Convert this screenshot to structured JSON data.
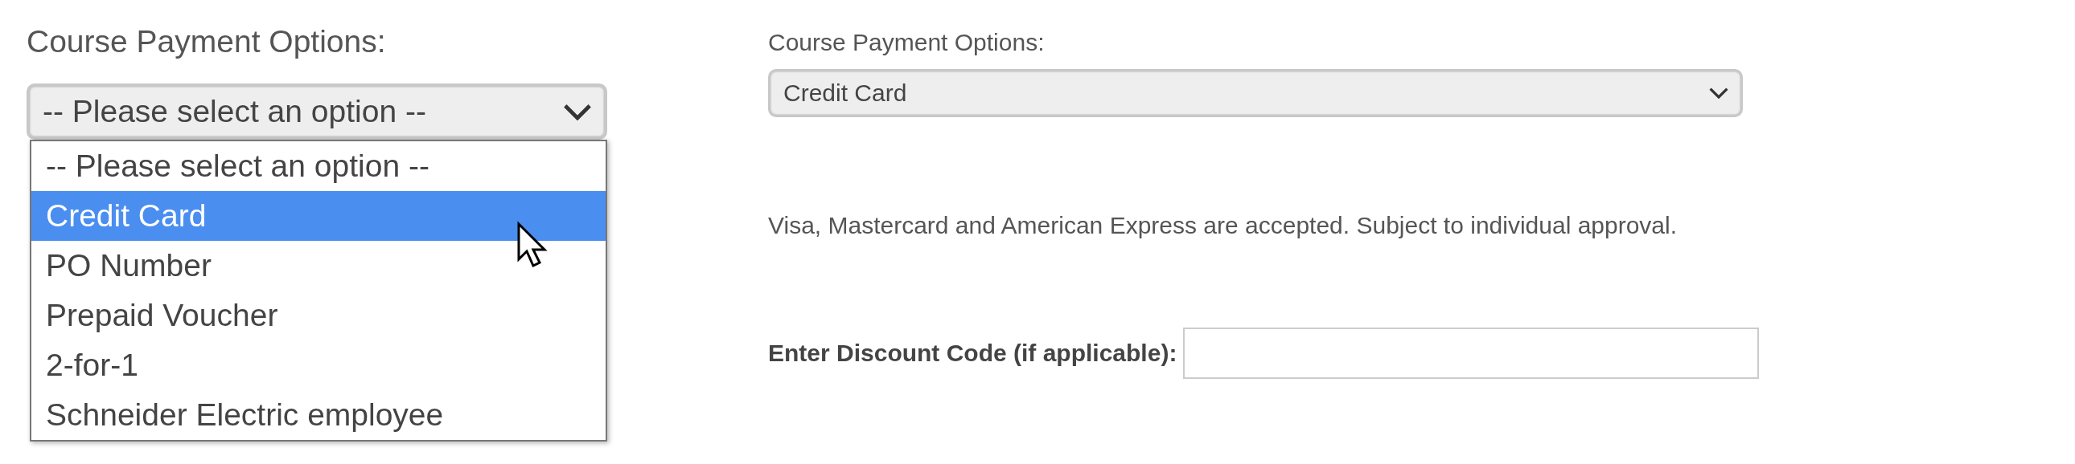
{
  "left_panel": {
    "label": "Course Payment Options:",
    "select": {
      "value": "-- Please select an option --",
      "expanded": true
    },
    "options": [
      {
        "label": "-- Please select an option --",
        "selected": false
      },
      {
        "label": "Credit Card",
        "selected": true
      },
      {
        "label": "PO Number",
        "selected": false
      },
      {
        "label": "Prepaid Voucher",
        "selected": false
      },
      {
        "label": "2-for-1",
        "selected": false
      },
      {
        "label": "Schneider Electric employee",
        "selected": false
      }
    ]
  },
  "right_panel": {
    "label": "Course Payment Options:",
    "select": {
      "value": "Credit Card"
    },
    "description": "Visa, Mastercard and American Express are accepted. Subject to individual approval.",
    "discount_label": "Enter Discount Code (if applicable):"
  }
}
